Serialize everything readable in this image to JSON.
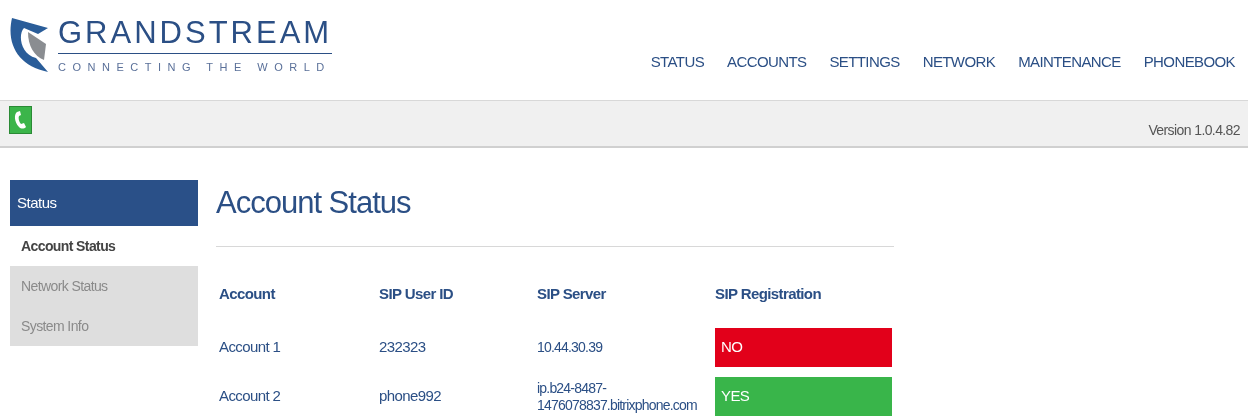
{
  "brand": {
    "name": "GRANDSTREAM",
    "tagline": "CONNECTING THE WORLD"
  },
  "nav": [
    "STATUS",
    "ACCOUNTS",
    "SETTINGS",
    "NETWORK",
    "MAINTENANCE",
    "PHONEBOOK"
  ],
  "version": "Version 1.0.4.82",
  "sidebar": {
    "section": "Status",
    "items": [
      {
        "label": "Account Status",
        "selected": true
      },
      {
        "label": "Network Status",
        "selected": false
      },
      {
        "label": "System Info",
        "selected": false
      }
    ]
  },
  "page_title": "Account Status",
  "table": {
    "columns": [
      "Account",
      "SIP User ID",
      "SIP Server",
      "SIP Registration"
    ],
    "rows": [
      {
        "account": "Account 1",
        "user_id": "232323",
        "server": "10.44.30.39",
        "registration": "NO",
        "registered": false
      },
      {
        "account": "Account 2",
        "user_id": "phone992",
        "server": "ip.b24-8487-1476078837.bitrixphone.com",
        "registration": "YES",
        "registered": true
      }
    ]
  }
}
